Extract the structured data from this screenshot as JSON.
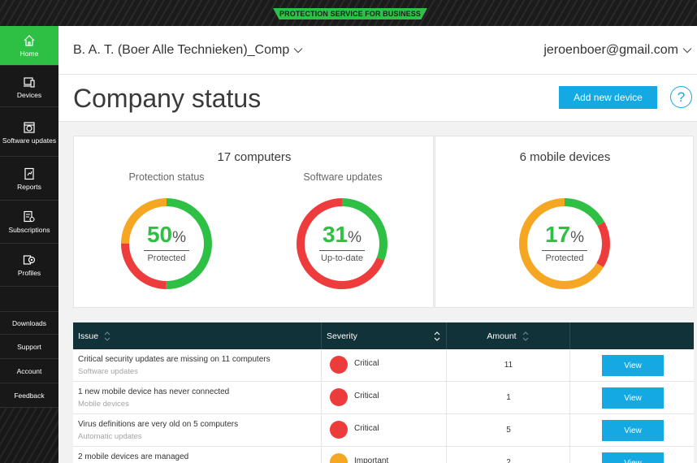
{
  "banner": {
    "text": "PROTECTION SERVICE FOR BUSINESS"
  },
  "sidebar": {
    "items": [
      {
        "label": "Home",
        "icon": "home-icon"
      },
      {
        "label": "Devices",
        "icon": "devices-icon"
      },
      {
        "label": "Software updates",
        "icon": "software-updates-icon"
      },
      {
        "label": "Reports",
        "icon": "reports-icon"
      },
      {
        "label": "Subscriptions",
        "icon": "subscriptions-icon"
      },
      {
        "label": "Profiles",
        "icon": "profiles-icon"
      }
    ],
    "links": [
      "Downloads",
      "Support",
      "Account",
      "Feedback"
    ]
  },
  "header": {
    "company": "B. A. T. (Boer Alle Technieken)_Comp",
    "user": "jeroenboer@gmail.com"
  },
  "page": {
    "title": "Company status",
    "add_device": "Add new device",
    "help": "?"
  },
  "computers": {
    "title": "17 computers",
    "protection": {
      "title": "Protection status",
      "value": "50",
      "sign": "%",
      "label": "Protected"
    },
    "updates": {
      "title": "Software updates",
      "value": "31",
      "sign": "%",
      "label": "Up-to-date"
    }
  },
  "mobile": {
    "title": "6 mobile devices",
    "protection": {
      "value": "17",
      "sign": "%",
      "label": "Protected"
    }
  },
  "table": {
    "headers": {
      "issue": "Issue",
      "severity": "Severity",
      "amount": "Amount"
    },
    "rows": [
      {
        "issue": "Critical security updates are missing on 11 computers",
        "category": "Software updates",
        "severity": "Critical",
        "amount": "11",
        "action": "View"
      },
      {
        "issue": "1 new mobile device has never connected",
        "category": "Mobile devices",
        "severity": "Critical",
        "amount": "1",
        "action": "View"
      },
      {
        "issue": "Virus definitions are very old on 5 computers",
        "category": "Automatic updates",
        "severity": "Critical",
        "amount": "5",
        "action": "View"
      },
      {
        "issue": "2 mobile devices are managed",
        "category": "",
        "severity": "Important",
        "amount": "2",
        "action": "View"
      }
    ]
  },
  "colors": {
    "accent_green": "#2ec045",
    "critical_red": "#ee3b3b",
    "important_orange": "#f5a623",
    "button_blue": "#14a9e3",
    "table_header": "#123239"
  }
}
